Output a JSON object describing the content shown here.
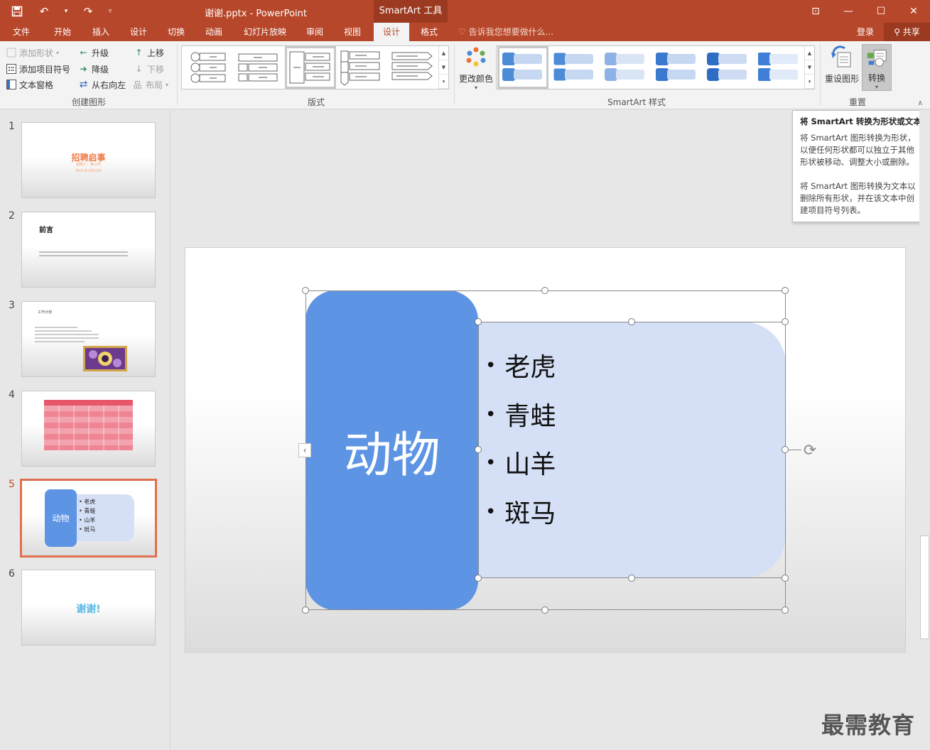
{
  "window": {
    "document_title": "谢谢.pptx - PowerPoint",
    "contextual_tab_title": "SmartArt 工具"
  },
  "tabs": [
    "文件",
    "开始",
    "插入",
    "设计",
    "切换",
    "动画",
    "幻灯片放映",
    "审阅",
    "视图",
    "设计",
    "格式"
  ],
  "active_tab_index": 9,
  "tellme": "告诉我您想要做什么...",
  "login": "登录",
  "share": "共享",
  "ribbon": {
    "create_graphic": {
      "label": "创建图形",
      "add_shape": "添加形状",
      "add_bullet": "添加项目符号",
      "text_pane": "文本窗格",
      "promote": "升级",
      "demote": "降级",
      "right_to_left": "从右向左",
      "move_up": "上移",
      "move_down": "下移",
      "layout": "布局"
    },
    "layouts": {
      "label": "版式"
    },
    "styles": {
      "label": "SmartArt 样式",
      "change_colors": "更改颜色"
    },
    "reset": {
      "label": "重置",
      "reset_graphic": "重设图形",
      "convert": "转换"
    }
  },
  "tooltip": {
    "title": "将 SmartArt 转换为形状或文本",
    "para1": "将 SmartArt 图形转换为形状，以便任何形状都可以独立于其他形状被移动、调整大小或删除。",
    "para2": "将 SmartArt 图形转换为文本以删除所有形状，并在该文本中创建项目符号列表。"
  },
  "slides": [
    {
      "num": "1",
      "title": "招聘启事",
      "sub1": "招聘人：某公司",
      "sub2": "2021年1月10日"
    },
    {
      "num": "2",
      "title": "前言"
    },
    {
      "num": "3",
      "title": "工作计划"
    },
    {
      "num": "4",
      "title": ""
    },
    {
      "num": "5",
      "main": "动物",
      "items": [
        "老虎",
        "青蛙",
        "山羊",
        "斑马"
      ]
    },
    {
      "num": "6",
      "title": "谢谢!"
    }
  ],
  "active_slide_index": 4,
  "smartart": {
    "main_label": "动物",
    "items": [
      "老虎",
      "青蛙",
      "山羊",
      "斑马"
    ]
  },
  "colors": {
    "accent": "#b7472a",
    "smartart_dark": "#5d94e3",
    "smartart_light": "#d5e0f7"
  },
  "watermark": "最需教育"
}
